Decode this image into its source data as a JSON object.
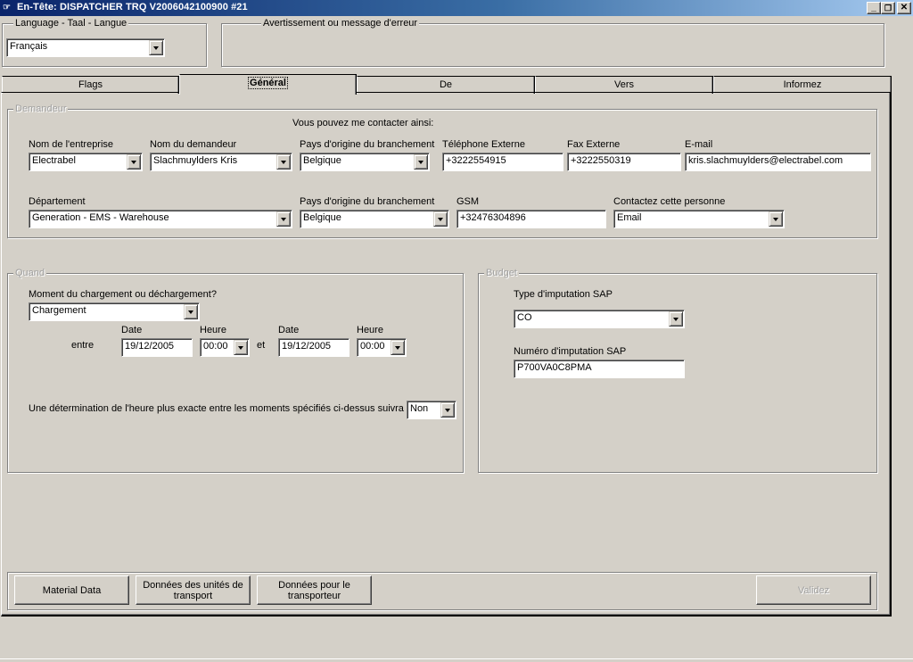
{
  "window": {
    "title": "En-Tête: DISPATCHER TRQ V2006042100900 #21",
    "app_icon": "pointing-hand-icon",
    "controls": {
      "minimize": "_",
      "restore": "❐",
      "close": "✕"
    }
  },
  "language": {
    "legend": "Language  - Taal  -  Langue",
    "selected": "Français"
  },
  "messages": {
    "legend": "Avertissement ou message d'erreur",
    "text": ""
  },
  "tabs": [
    {
      "label": "Flags",
      "active": false
    },
    {
      "label": "Général",
      "active": true
    },
    {
      "label": "De",
      "active": false
    },
    {
      "label": "Vers",
      "active": false
    },
    {
      "label": "Informez",
      "active": false
    }
  ],
  "demandeur": {
    "legend": "Demandeur",
    "contact_hint": "Vous pouvez me contacter ainsi:",
    "company": {
      "label": "Nom de l'entreprise",
      "value": "Electrabel"
    },
    "requester": {
      "label": "Nom du demandeur",
      "value": "Slachmuylders Kris"
    },
    "country1": {
      "label": "Pays d'origine du branchement",
      "value": "Belgique"
    },
    "phone": {
      "label": "Téléphone Externe",
      "value": "+3222554915"
    },
    "fax": {
      "label": "Fax Externe",
      "value": "+3222550319"
    },
    "email": {
      "label": "E-mail",
      "value": "kris.slachmuylders@electrabel.com"
    },
    "department": {
      "label": "Département",
      "value": "Generation - EMS - Warehouse"
    },
    "country2": {
      "label": "Pays d'origine du branchement",
      "value": "Belgique"
    },
    "gsm": {
      "label": "GSM",
      "value": "+32476304896"
    },
    "contact_method": {
      "label": "Contactez cette personne",
      "value": "Email"
    }
  },
  "quand": {
    "legend": "Quand",
    "moment": {
      "label": "Moment du chargement ou déchargement?",
      "value": "Chargement"
    },
    "entre_label": "entre",
    "et_label": "et",
    "date_label": "Date",
    "heure_label": "Heure",
    "from_date": "19/12/2005",
    "from_time": "00:00",
    "to_date": "19/12/2005",
    "to_time": "00:00",
    "exact": {
      "label": "Une détermination de l'heure plus exacte entre les moments spécifiés ci-dessus suivra",
      "value": "Non"
    }
  },
  "budget": {
    "legend": "Budget",
    "type": {
      "label": "Type d'imputation SAP",
      "value": "CO"
    },
    "number": {
      "label": "Numéro d'imputation SAP",
      "value": "P700VA0C8PMA"
    }
  },
  "footer": {
    "material_data": "Material Data",
    "transport_units": "Données des unités de transport",
    "carrier_data": "Données pour le transporteur",
    "validate": "Validez"
  }
}
